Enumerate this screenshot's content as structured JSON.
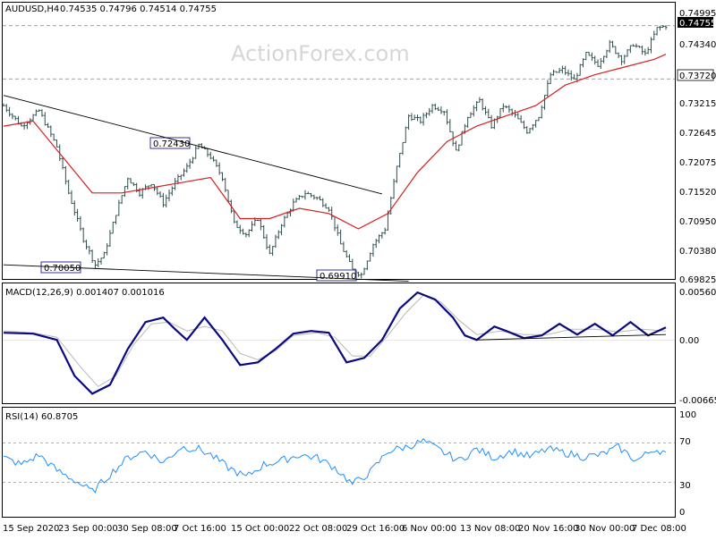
{
  "header": {
    "symbol": "AUDUSD,H4",
    "ohlc": "0.74535 0.74796 0.74514 0.74755"
  },
  "watermark": "ActionForex.com",
  "colors": {
    "background": "#ffffff",
    "bars": "#2f4f4f",
    "ma": "#d62020",
    "macd": "#0a0a80",
    "signal": "#b8b8b8",
    "rsi": "#1e90ff",
    "annotation_box": "#000080",
    "grid_dash": "#808080"
  },
  "chart_data": [
    {
      "type": "ohlc",
      "panel": "price",
      "timeframe": "H4",
      "ylim": [
        0.69825,
        0.74995
      ],
      "y_ticks": [
        "0.74995",
        "0.74340",
        "0.73720",
        "0.73215",
        "0.72645",
        "0.72075",
        "0.71520",
        "0.70950",
        "0.70380",
        "0.69825"
      ],
      "current_price_label": "0.74755",
      "dashed_levels": [
        {
          "value": 0.7372,
          "label": "0.73720"
        },
        {
          "value": 0.74755
        }
      ],
      "x_ticks": [
        "15 Sep 2020",
        "23 Sep 00:00",
        "30 Sep 08:00",
        "7 Oct 16:00",
        "15 Oct 00:00",
        "22 Oct 08:00",
        "29 Oct 16:00",
        "6 Nov 00:00",
        "13 Nov 08:00",
        "20 Nov 16:00",
        "30 Nov 00:00",
        "7 Dec 08:00"
      ],
      "close_path": [
        [
          0,
          0.732
        ],
        [
          6,
          0.728
        ],
        [
          12,
          0.731
        ],
        [
          18,
          0.724
        ],
        [
          22,
          0.715
        ],
        [
          27,
          0.706
        ],
        [
          31,
          0.701
        ],
        [
          34,
          0.703
        ],
        [
          38,
          0.711
        ],
        [
          42,
          0.718
        ],
        [
          46,
          0.715
        ],
        [
          50,
          0.717
        ],
        [
          54,
          0.713
        ],
        [
          58,
          0.717
        ],
        [
          62,
          0.72
        ],
        [
          66,
          0.7243
        ],
        [
          70,
          0.722
        ],
        [
          74,
          0.718
        ],
        [
          78,
          0.709
        ],
        [
          82,
          0.707
        ],
        [
          86,
          0.71
        ],
        [
          90,
          0.703
        ],
        [
          94,
          0.709
        ],
        [
          98,
          0.713
        ],
        [
          102,
          0.715
        ],
        [
          106,
          0.714
        ],
        [
          110,
          0.712
        ],
        [
          114,
          0.705
        ],
        [
          118,
          0.7
        ],
        [
          121,
          0.6991
        ],
        [
          125,
          0.705
        ],
        [
          129,
          0.708
        ],
        [
          133,
          0.72
        ],
        [
          137,
          0.73
        ],
        [
          141,
          0.729
        ],
        [
          145,
          0.732
        ],
        [
          149,
          0.731
        ],
        [
          153,
          0.723
        ],
        [
          157,
          0.73
        ],
        [
          161,
          0.733
        ],
        [
          165,
          0.728
        ],
        [
          169,
          0.732
        ],
        [
          173,
          0.73
        ],
        [
          177,
          0.727
        ],
        [
          181,
          0.73
        ],
        [
          185,
          0.738
        ],
        [
          189,
          0.739
        ],
        [
          193,
          0.737
        ],
        [
          197,
          0.742
        ],
        [
          201,
          0.74
        ],
        [
          205,
          0.744
        ],
        [
          209,
          0.741
        ],
        [
          213,
          0.744
        ],
        [
          217,
          0.742
        ],
        [
          221,
          0.747
        ],
        [
          224,
          0.74755
        ]
      ],
      "ma_path": [
        [
          0,
          0.728
        ],
        [
          10,
          0.729
        ],
        [
          20,
          0.722
        ],
        [
          30,
          0.715
        ],
        [
          40,
          0.715
        ],
        [
          50,
          0.716
        ],
        [
          60,
          0.717
        ],
        [
          70,
          0.718
        ],
        [
          80,
          0.71
        ],
        [
          90,
          0.71
        ],
        [
          100,
          0.712
        ],
        [
          110,
          0.711
        ],
        [
          120,
          0.708
        ],
        [
          130,
          0.711
        ],
        [
          140,
          0.719
        ],
        [
          150,
          0.725
        ],
        [
          160,
          0.728
        ],
        [
          170,
          0.73
        ],
        [
          180,
          0.732
        ],
        [
          190,
          0.736
        ],
        [
          200,
          0.738
        ],
        [
          210,
          0.7395
        ],
        [
          220,
          0.741
        ],
        [
          224,
          0.742
        ]
      ],
      "annotations": [
        {
          "label": "0.72430",
          "bar": 53,
          "value": 0.7243
        },
        {
          "label": "0.70050",
          "bar": 20,
          "value": 0.7005
        },
        {
          "label": "0.69910",
          "bar": 117,
          "value": 0.6991
        }
      ],
      "trendlines": [
        {
          "from": [
            0,
            0.734
          ],
          "to": [
            128,
            0.7148
          ]
        },
        {
          "from": [
            0,
            0.701
          ],
          "to": [
            137,
            0.6978
          ]
        }
      ]
    },
    {
      "type": "line",
      "panel": "macd",
      "title": "MACD(12,26,9) 0.001407 0.001016",
      "ylim": [
        -0.006656,
        0.005607
      ],
      "y_ticks": [
        "0.005607",
        "0.00",
        "-0.006656"
      ],
      "series": [
        {
          "name": "MACD",
          "points": [
            [
              0,
              0.0008
            ],
            [
              10,
              0.0007
            ],
            [
              18,
              0.0
            ],
            [
              24,
              -0.004
            ],
            [
              30,
              -0.006
            ],
            [
              36,
              -0.005
            ],
            [
              42,
              -0.001
            ],
            [
              48,
              0.002
            ],
            [
              54,
              0.0025
            ],
            [
              58,
              0.0012
            ],
            [
              62,
              0.0
            ],
            [
              68,
              0.0025
            ],
            [
              74,
              0.0
            ],
            [
              80,
              -0.0028
            ],
            [
              86,
              -0.0025
            ],
            [
              92,
              -0.001
            ],
            [
              98,
              0.0007
            ],
            [
              104,
              0.001
            ],
            [
              110,
              0.0008
            ],
            [
              116,
              -0.0025
            ],
            [
              122,
              -0.002
            ],
            [
              128,
              0.0
            ],
            [
              134,
              0.0035
            ],
            [
              140,
              0.0053
            ],
            [
              146,
              0.0045
            ],
            [
              152,
              0.0025
            ],
            [
              156,
              0.0005
            ],
            [
              160,
              0.0
            ],
            [
              166,
              0.0015
            ],
            [
              170,
              0.001
            ],
            [
              176,
              0.0002
            ],
            [
              182,
              0.0005
            ],
            [
              188,
              0.0018
            ],
            [
              194,
              0.0006
            ],
            [
              200,
              0.0018
            ],
            [
              206,
              0.0005
            ],
            [
              212,
              0.002
            ],
            [
              218,
              0.0005
            ],
            [
              224,
              0.0014
            ]
          ]
        },
        {
          "name": "Signal",
          "points": [
            [
              0,
              0.001
            ],
            [
              10,
              0.0008
            ],
            [
              18,
              0.0003
            ],
            [
              26,
              -0.003
            ],
            [
              32,
              -0.0052
            ],
            [
              38,
              -0.004
            ],
            [
              44,
              -0.0005
            ],
            [
              50,
              0.0018
            ],
            [
              56,
              0.002
            ],
            [
              62,
              0.001
            ],
            [
              68,
              0.0015
            ],
            [
              74,
              0.001
            ],
            [
              80,
              -0.0015
            ],
            [
              86,
              -0.0022
            ],
            [
              92,
              -0.0012
            ],
            [
              98,
              0.0005
            ],
            [
              106,
              0.0008
            ],
            [
              112,
              0.0003
            ],
            [
              118,
              -0.0018
            ],
            [
              124,
              -0.0018
            ],
            [
              130,
              0.0005
            ],
            [
              136,
              0.003
            ],
            [
              142,
              0.005
            ],
            [
              148,
              0.0042
            ],
            [
              154,
              0.0022
            ],
            [
              160,
              0.0006
            ],
            [
              168,
              0.001
            ],
            [
              176,
              0.0006
            ],
            [
              184,
              0.0006
            ],
            [
              192,
              0.0012
            ],
            [
              200,
              0.0012
            ],
            [
              208,
              0.0009
            ],
            [
              216,
              0.0012
            ],
            [
              224,
              0.001
            ]
          ]
        }
      ],
      "trendline": {
        "from": [
          160,
          0.0
        ],
        "to": [
          224,
          0.0006
        ]
      }
    },
    {
      "type": "line",
      "panel": "rsi",
      "title": "RSI(14) 60.8705",
      "ylim": [
        0,
        100
      ],
      "y_ticks": [
        "100",
        "70",
        "30",
        "0"
      ],
      "levels": [
        70,
        30
      ],
      "series": [
        {
          "name": "RSI(14)",
          "points": [
            [
              0,
              55
            ],
            [
              6,
              48
            ],
            [
              12,
              58
            ],
            [
              18,
              42
            ],
            [
              24,
              32
            ],
            [
              30,
              20
            ],
            [
              36,
              38
            ],
            [
              42,
              55
            ],
            [
              48,
              62
            ],
            [
              54,
              50
            ],
            [
              60,
              66
            ],
            [
              66,
              64
            ],
            [
              70,
              58
            ],
            [
              76,
              45
            ],
            [
              82,
              35
            ],
            [
              88,
              48
            ],
            [
              94,
              52
            ],
            [
              100,
              58
            ],
            [
              106,
              55
            ],
            [
              112,
              45
            ],
            [
              118,
              28
            ],
            [
              124,
              40
            ],
            [
              130,
              62
            ],
            [
              136,
              66
            ],
            [
              142,
              72
            ],
            [
              148,
              62
            ],
            [
              154,
              52
            ],
            [
              160,
              64
            ],
            [
              166,
              55
            ],
            [
              172,
              62
            ],
            [
              178,
              56
            ],
            [
              184,
              64
            ],
            [
              190,
              60
            ],
            [
              196,
              56
            ],
            [
              202,
              58
            ],
            [
              208,
              66
            ],
            [
              214,
              52
            ],
            [
              220,
              64
            ],
            [
              224,
              60.87
            ]
          ]
        }
      ]
    }
  ]
}
